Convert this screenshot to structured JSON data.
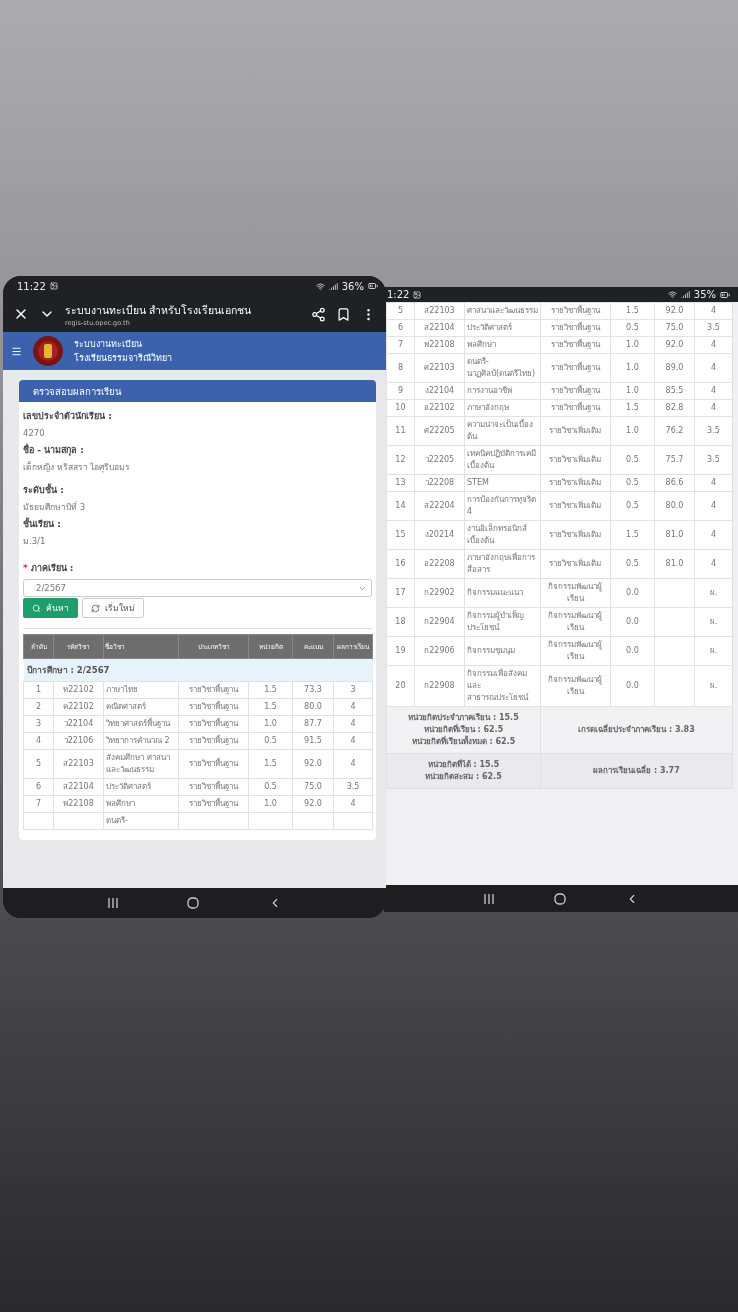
{
  "left_phone": {
    "status_bar": {
      "time": "11:22",
      "battery": "36%"
    },
    "browser_bar": {
      "title": "ระบบงานทะเบียน สำหรับโรงเรียนเอกชน",
      "url": "regis-stu.opec.go.th"
    },
    "site_header": {
      "title": "ระบบงานทะเบียน",
      "subtitle": "โรงเรียนธรรมจาริณีวิทยา"
    },
    "card": {
      "title": "ตรวจสอบผลการเรียน",
      "fields": [
        {
          "label": "เลขประจำตัวนักเรียน :",
          "value": "4270"
        },
        {
          "label": "ชื่อ - นามสกุล :",
          "value": "เด็กหญิง หริสสรา ไอศุริบอมร"
        },
        {
          "label": "ระดับชั้น :",
          "value": "มัธยมศึกษาปีที่ 3"
        },
        {
          "label": "ชั้นเรียน :",
          "value": "ม.3/1"
        }
      ],
      "semester": {
        "marker": "*",
        "label": "ภาคเรียน :",
        "value": "2/2567"
      },
      "buttons": [
        {
          "kind": "primary",
          "label": "ค้นหา"
        },
        {
          "kind": "default",
          "label": "เริ่มใหม่"
        }
      ]
    },
    "table": {
      "columns": [
        "ลำดับ",
        "รหัสวิชา",
        "ชื่อวิชา",
        "ประเภทวิชา",
        "หน่วยกิต",
        "คะแนน",
        "ผลการเรียน"
      ],
      "group_label": "ปีการศึกษา : 2/2567",
      "rows": [
        {
          "no": "1",
          "code": "ท22102",
          "name": "ภาษาไทย",
          "type": "รายวิชาพื้นฐาน",
          "credit": "1.5",
          "score": "73.3",
          "grade": "3"
        },
        {
          "no": "2",
          "code": "ค22102",
          "name": "คณิตศาสตร์",
          "type": "รายวิชาพื้นฐาน",
          "credit": "1.5",
          "score": "80.0",
          "grade": "4"
        },
        {
          "no": "3",
          "code": "ว22104",
          "name": "วิทยาศาสตร์พื้นฐาน",
          "type": "รายวิชาพื้นฐาน",
          "credit": "1.0",
          "score": "87.7",
          "grade": "4"
        },
        {
          "no": "4",
          "code": "ว22106",
          "name": "วิทยาการคำนวณ 2",
          "type": "รายวิชาพื้นฐาน",
          "credit": "0.5",
          "score": "91.5",
          "grade": "4"
        },
        {
          "no": "5",
          "code": "ส22103",
          "name": "สังคมศึกษา ศาสนาและวัฒนธรรม",
          "type": "รายวิชาพื้นฐาน",
          "credit": "1.5",
          "score": "92.0",
          "grade": "4"
        },
        {
          "no": "6",
          "code": "ส22104",
          "name": "ประวัติศาสตร์",
          "type": "รายวิชาพื้นฐาน",
          "credit": "0.5",
          "score": "75.0",
          "grade": "3.5"
        },
        {
          "no": "7",
          "code": "พ22108",
          "name": "พลศึกษา",
          "type": "รายวิชาพื้นฐาน",
          "credit": "1.0",
          "score": "92.0",
          "grade": "4"
        },
        {
          "name": "ดนตรี-"
        }
      ]
    }
  },
  "right_phone": {
    "status_bar": {
      "time": "1:22",
      "battery": "35%"
    },
    "rows": [
      {
        "no": "5",
        "code": "ส22103",
        "name": "ศาสนาและวัฒนธรรม",
        "type": "รายวิชาพื้นฐาน",
        "credit": "1.5",
        "score": "92.0",
        "grade": "4"
      },
      {
        "no": "6",
        "code": "ส22104",
        "name": "ประวัติศาสตร์",
        "type": "รายวิชาพื้นฐาน",
        "credit": "0.5",
        "score": "75.0",
        "grade": "3.5"
      },
      {
        "no": "7",
        "code": "พ22108",
        "name": "พลศึกษา",
        "type": "รายวิชาพื้นฐาน",
        "credit": "1.0",
        "score": "92.0",
        "grade": "4"
      },
      {
        "no": "8",
        "code": "ศ22103",
        "name": "ดนตรี-นาฏศิลป์(ดนตรีไทย)",
        "type": "รายวิชาพื้นฐาน",
        "credit": "1.0",
        "score": "89.0",
        "grade": "4"
      },
      {
        "no": "9",
        "code": "ง22104",
        "name": "การงานอาชีพ",
        "type": "รายวิชาพื้นฐาน",
        "credit": "1.0",
        "score": "85.5",
        "grade": "4"
      },
      {
        "no": "10",
        "code": "อ22102",
        "name": "ภาษาอังกฤษ",
        "type": "รายวิชาพื้นฐาน",
        "credit": "1.5",
        "score": "82.8",
        "grade": "4"
      },
      {
        "no": "11",
        "code": "ศ22205",
        "name": "ความน่าจะเป็นเบื้องต้น",
        "type": "รายวิชาเพิ่มเติม",
        "credit": "1.0",
        "score": "76.2",
        "grade": "3.5"
      },
      {
        "no": "12",
        "code": "ว22205",
        "name": "เทคนิคปฏิบัติการเคมีเบื้องต้น",
        "type": "รายวิชาเพิ่มเติม",
        "credit": "0.5",
        "score": "75.7",
        "grade": "3.5"
      },
      {
        "no": "13",
        "code": "ว22208",
        "name": "STEM",
        "type": "รายวิชาเพิ่มเติม",
        "credit": "0.5",
        "score": "86.6",
        "grade": "4"
      },
      {
        "no": "14",
        "code": "ส22204",
        "name": "การป้องกันการทุจริต 4",
        "type": "รายวิชาเพิ่มเติม",
        "credit": "0.5",
        "score": "80.0",
        "grade": "4"
      },
      {
        "no": "15",
        "code": "ง20214",
        "name": "งานอิเล็กทรอนิกส์เบื้องต้น",
        "type": "รายวิชาเพิ่มเติม",
        "credit": "1.5",
        "score": "81.0",
        "grade": "4"
      },
      {
        "no": "16",
        "code": "อ22208",
        "name": "ภาษาอังกฤษเพื่อการสื่อสาร",
        "type": "รายวิชาเพิ่มเติม",
        "credit": "0.5",
        "score": "81.0",
        "grade": "4"
      },
      {
        "no": "17",
        "code": "ก22902",
        "name": "กิจกรรมแนะแนว",
        "type": "กิจกรรมพัฒนาผู้เรียน",
        "credit": "0.0",
        "grade": "ผ."
      },
      {
        "no": "18",
        "code": "ก22904",
        "name": "กิจกรรมผู้บำเพ็ญประโยชน์",
        "type": "กิจกรรมพัฒนาผู้เรียน",
        "credit": "0.0",
        "grade": "ผ."
      },
      {
        "no": "19",
        "code": "ก22906",
        "name": "กิจกรรมชุมนุม",
        "type": "กิจกรรมพัฒนาผู้เรียน",
        "credit": "0.0",
        "grade": "ผ."
      },
      {
        "no": "20",
        "code": "ก22908",
        "name": "กิจกรรมเพื่อสังคมและสาธารณประโยชน์",
        "type": "กิจกรรมพัฒนาผู้เรียน",
        "credit": "0.0",
        "grade": "ผ."
      }
    ],
    "summary": [
      {
        "left": [
          "หน่วยกิตประจำภาคเรียน : 15.5",
          "หน่วยกิตที่เรียน : 62.5",
          "หน่วยกิตที่เรียนทั้งหมด : 62.5"
        ],
        "right": "เกรดเฉลี่ยประจำภาคเรียน : 3.83"
      },
      {
        "left": [
          "หน่วยกิตที่ได้ : 15.5",
          "หน่วยกิตสะสม : 62.5"
        ],
        "right": "ผลการเรียนเฉลี่ย : 3.77"
      }
    ]
  }
}
